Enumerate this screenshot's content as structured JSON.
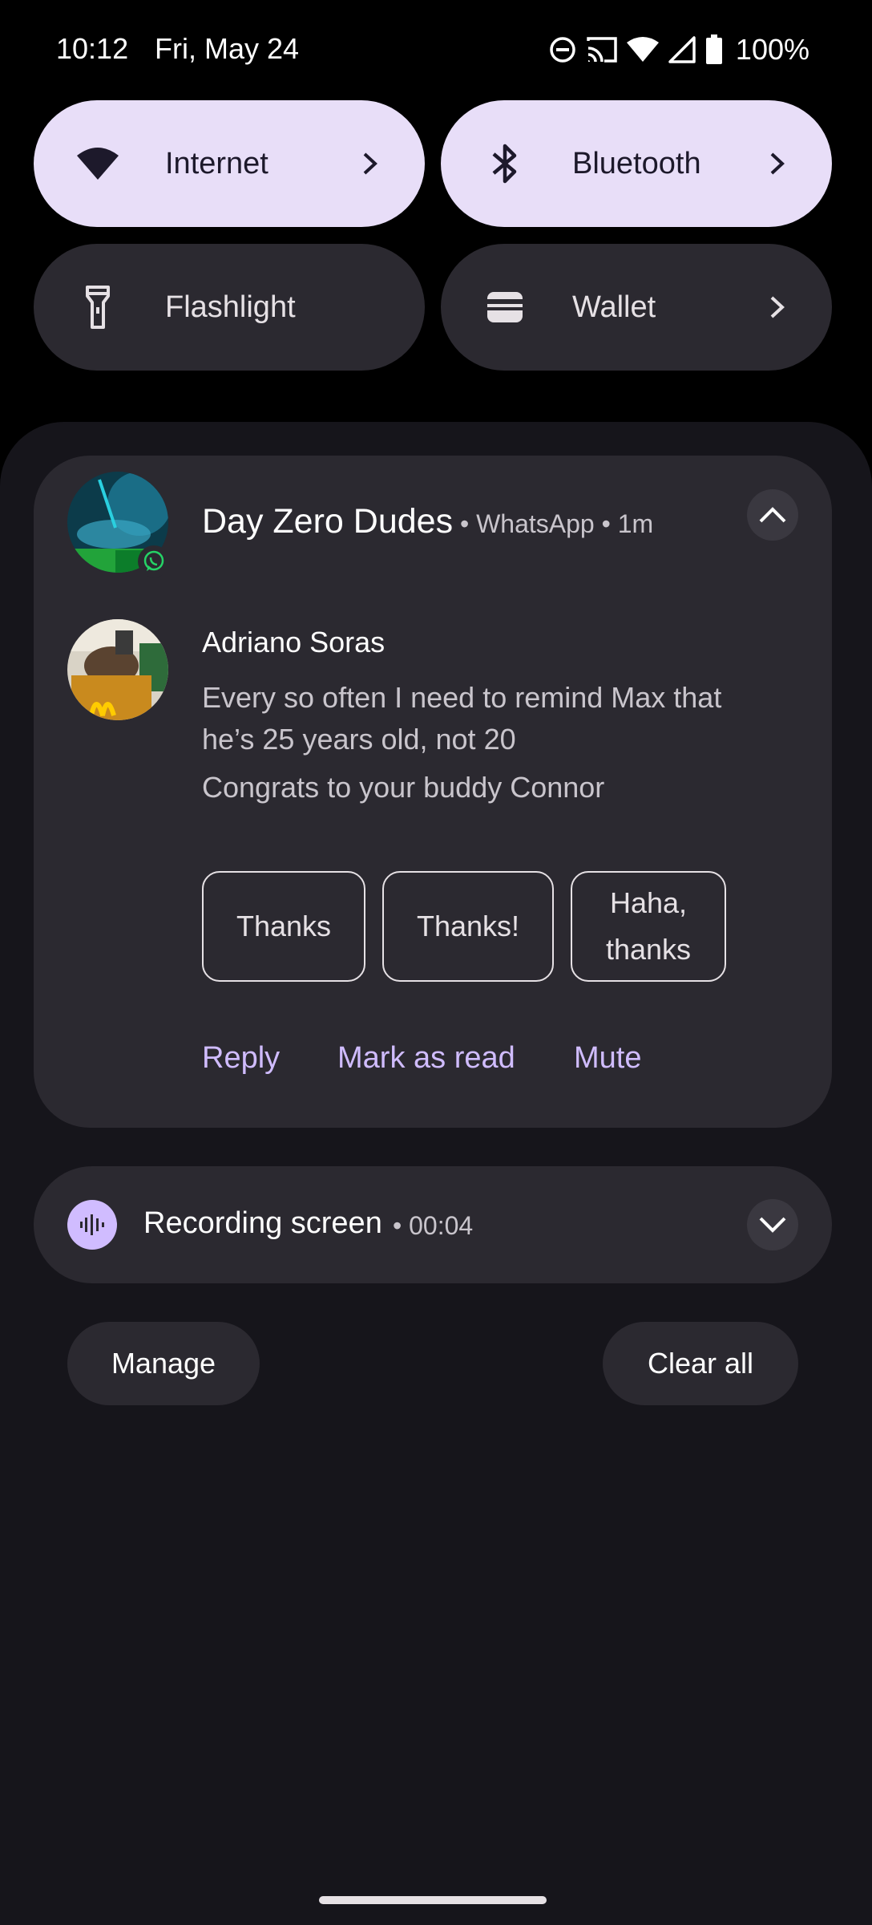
{
  "status_bar": {
    "time": "10:12",
    "date": "Fri, May 24",
    "battery": "100%",
    "icons": [
      "do-not-disturb-icon",
      "cast-icon",
      "wifi-icon",
      "cell-signal-icon",
      "battery-icon"
    ]
  },
  "quick_settings": {
    "tiles": [
      {
        "label": "Internet",
        "icon": "wifi-icon",
        "state": "on",
        "has_chevron": true
      },
      {
        "label": "Bluetooth",
        "icon": "bluetooth-icon",
        "state": "on",
        "has_chevron": true
      },
      {
        "label": "Flashlight",
        "icon": "flashlight-icon",
        "state": "off",
        "has_chevron": false
      },
      {
        "label": "Wallet",
        "icon": "wallet-icon",
        "state": "off",
        "has_chevron": true
      }
    ]
  },
  "notification": {
    "title": "Day Zero Dudes",
    "app_name": "WhatsApp",
    "time_ago": "1m",
    "sub_line": "• WhatsApp • 1m",
    "sender": "Adriano Soras",
    "messages": [
      "Every so often I need to remind Max that he’s 25 years old, not 20",
      "Congrats to your buddy Connor"
    ],
    "smart_replies": [
      "Thanks",
      "Thanks!",
      "Haha, thanks"
    ],
    "actions": [
      "Reply",
      "Mark as read",
      "Mute"
    ]
  },
  "recording": {
    "title": "Recording screen",
    "elapsed": "00:04",
    "sub_line": "• 00:04"
  },
  "footer": {
    "manage_label": "Manage",
    "clear_all_label": "Clear all"
  },
  "colors": {
    "background": "#000000",
    "shade": "#16151b",
    "card": "#2b2930",
    "tile_on": "#e8def8",
    "accent": "#d0bcff"
  }
}
